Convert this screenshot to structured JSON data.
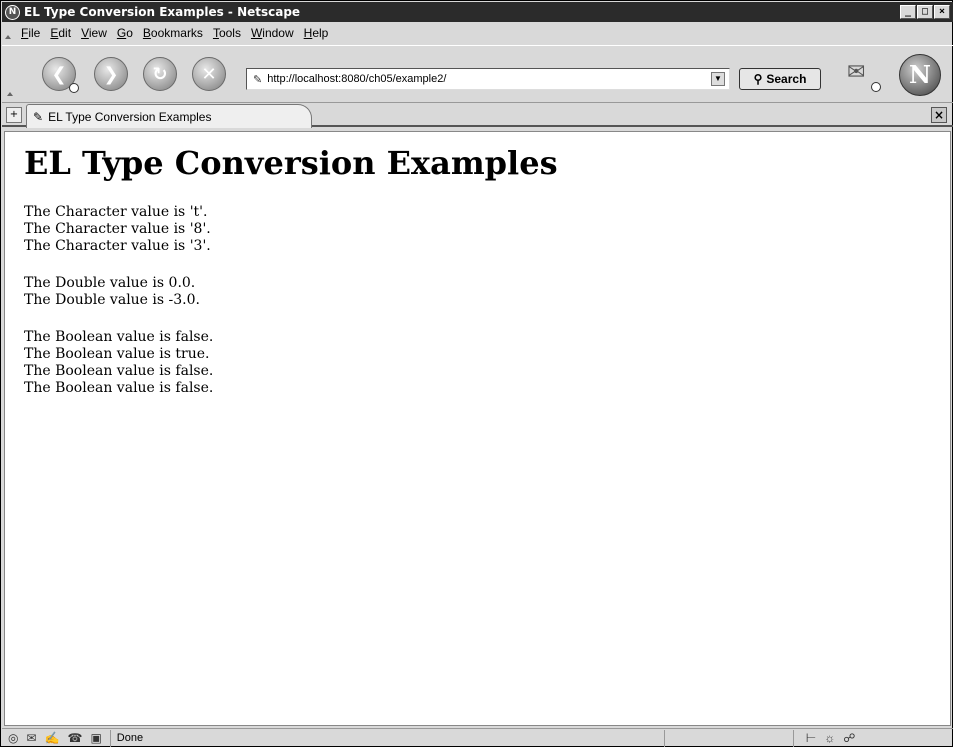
{
  "window": {
    "title": "EL Type Conversion Examples - Netscape",
    "app_icon": "N",
    "wm_buttons": [
      "_",
      "□",
      "×"
    ]
  },
  "menu": {
    "items": [
      {
        "underline": "F",
        "rest": "ile"
      },
      {
        "underline": "E",
        "rest": "dit"
      },
      {
        "underline": "V",
        "rest": "iew"
      },
      {
        "underline": "G",
        "rest": "o"
      },
      {
        "underline": "B",
        "rest": "ookmarks"
      },
      {
        "underline": "T",
        "rest": "ools"
      },
      {
        "underline": "W",
        "rest": "indow"
      },
      {
        "underline": "H",
        "rest": "elp"
      }
    ]
  },
  "toolbar": {
    "back_icon": "back-icon",
    "forward_icon": "forward-icon",
    "reload_icon": "reload-icon",
    "stop_icon": "stop-icon",
    "url": "http://localhost:8080/ch05/example2/",
    "search_label": "Search",
    "logo_letter": "N"
  },
  "tabs": [
    {
      "label": "EL Type Conversion Examples"
    }
  ],
  "page": {
    "heading": "EL Type Conversion Examples",
    "groups": [
      [
        "The Character value is 't'.",
        "The Character value is '8'.",
        "The Character value is '3'."
      ],
      [
        "The Double value is 0.0.",
        "The Double value is -3.0."
      ],
      [
        "The Boolean value is false.",
        "The Boolean value is true.",
        "The Boolean value is false.",
        "The Boolean value is false."
      ]
    ]
  },
  "status": {
    "text": "Done"
  }
}
